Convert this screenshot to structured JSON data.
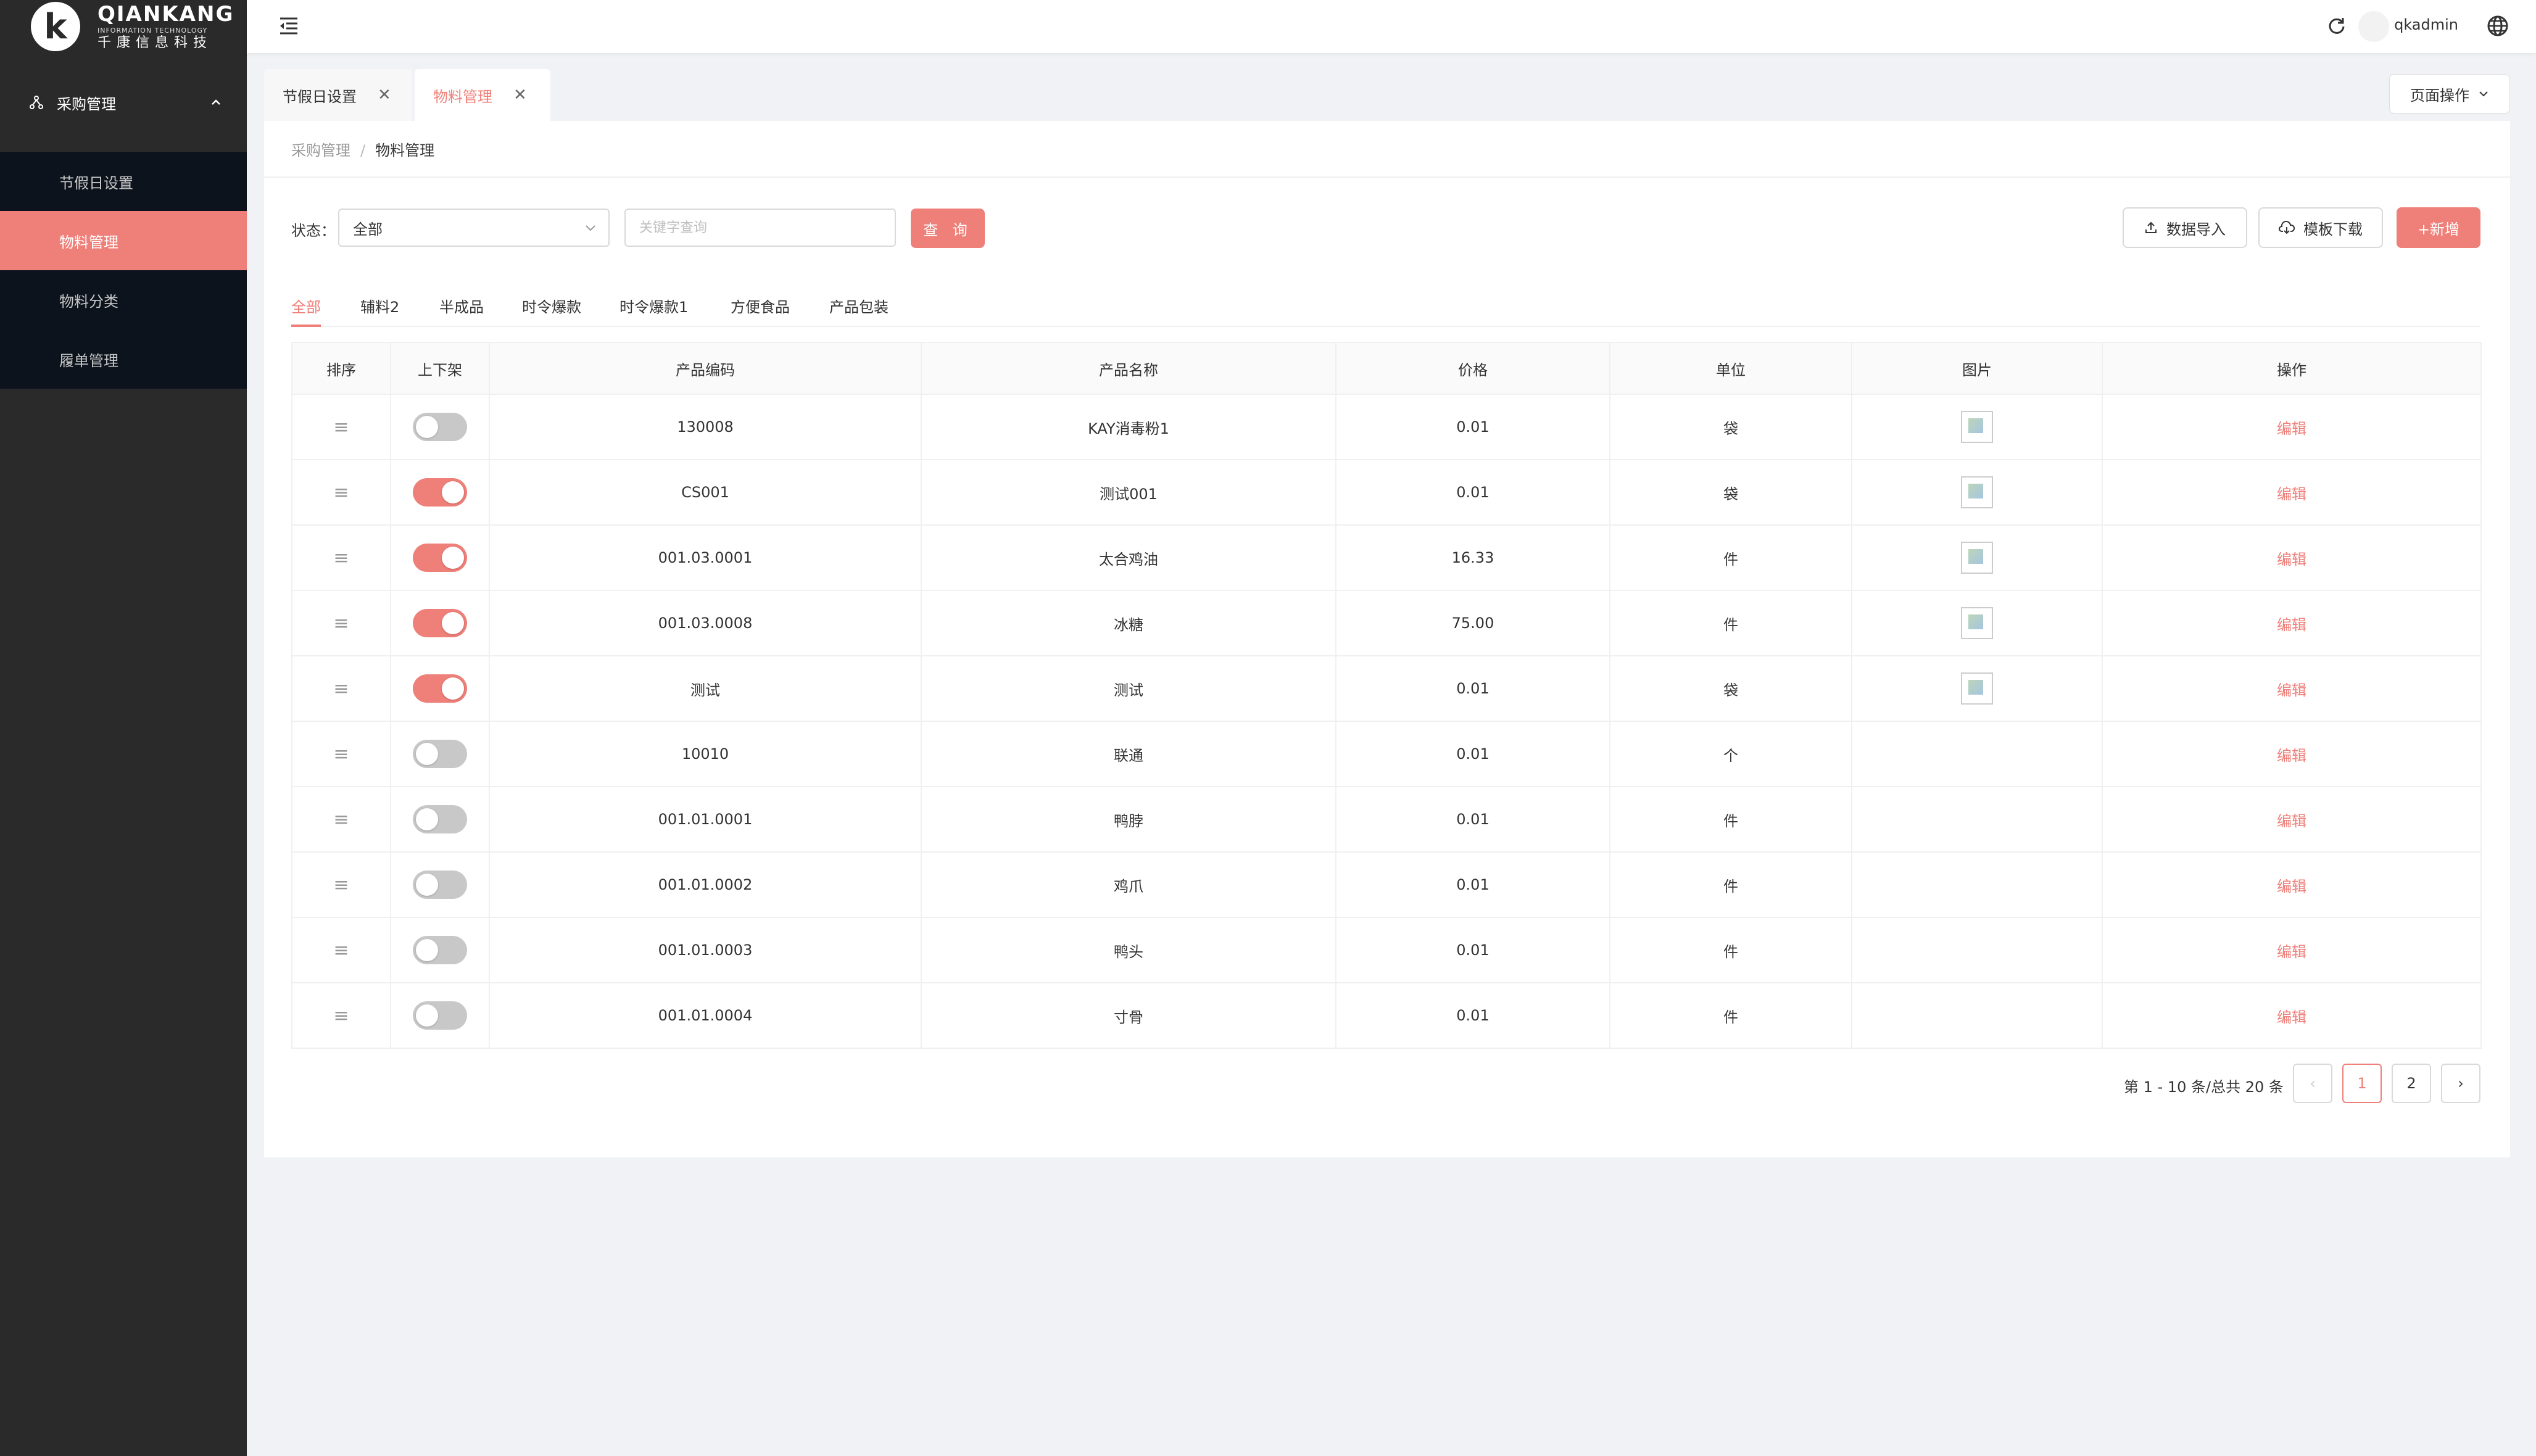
{
  "brand": {
    "mark": "k",
    "title": "QIANKANG",
    "subtitle": "INFORMATION TECHNOLOGY",
    "cn": "千康信息科技"
  },
  "sidebar": {
    "group": {
      "label": "采购管理",
      "icon": "sitemap-icon",
      "expanded": true
    },
    "items": [
      {
        "label": "节假日设置",
        "active": false
      },
      {
        "label": "物料管理",
        "active": true
      },
      {
        "label": "物料分类",
        "active": false
      },
      {
        "label": "履单管理",
        "active": false
      }
    ]
  },
  "header": {
    "username": "qkadmin"
  },
  "tabs": [
    {
      "label": "节假日设置",
      "active": false
    },
    {
      "label": "物料管理",
      "active": true
    }
  ],
  "page_ops_label": "页面操作",
  "breadcrumb": {
    "parent": "采购管理",
    "separator": "/",
    "current": "物料管理"
  },
  "filter": {
    "status_label": "状态：",
    "status_value": "全部",
    "search_placeholder": "关键字查询",
    "query_button": "查 询"
  },
  "actions": {
    "import": "数据导入",
    "template": "模板下载",
    "add": "+新增"
  },
  "categories": [
    {
      "label": "全部",
      "active": true
    },
    {
      "label": "辅料2",
      "active": false
    },
    {
      "label": "半成品",
      "active": false
    },
    {
      "label": "时令爆款",
      "active": false
    },
    {
      "label": "时令爆款1",
      "active": false
    },
    {
      "label": "方便食品",
      "active": false
    },
    {
      "label": "产品包装",
      "active": false
    }
  ],
  "table": {
    "headers": [
      "排序",
      "上下架",
      "产品编码",
      "产品名称",
      "价格",
      "单位",
      "图片",
      "操作"
    ],
    "edit_label": "编辑",
    "rows": [
      {
        "code": "130008",
        "name": "KAY消毒粉1",
        "price": "0.01",
        "unit": "袋",
        "on": false,
        "image": true
      },
      {
        "code": "CS001",
        "name": "测试001",
        "price": "0.01",
        "unit": "袋",
        "on": true,
        "image": true
      },
      {
        "code": "001.03.0001",
        "name": "太合鸡油",
        "price": "16.33",
        "unit": "件",
        "on": true,
        "image": true
      },
      {
        "code": "001.03.0008",
        "name": "冰糖",
        "price": "75.00",
        "unit": "件",
        "on": true,
        "image": true
      },
      {
        "code": "测试",
        "name": "测试",
        "price": "0.01",
        "unit": "袋",
        "on": true,
        "image": true
      },
      {
        "code": "10010",
        "name": "联通",
        "price": "0.01",
        "unit": "个",
        "on": false,
        "image": false
      },
      {
        "code": "001.01.0001",
        "name": "鸭脖",
        "price": "0.01",
        "unit": "件",
        "on": false,
        "image": false
      },
      {
        "code": "001.01.0002",
        "name": "鸡爪",
        "price": "0.01",
        "unit": "件",
        "on": false,
        "image": false
      },
      {
        "code": "001.01.0003",
        "name": "鸭头",
        "price": "0.01",
        "unit": "件",
        "on": false,
        "image": false
      },
      {
        "code": "001.01.0004",
        "name": "寸骨",
        "price": "0.01",
        "unit": "件",
        "on": false,
        "image": false
      }
    ]
  },
  "pagination": {
    "summary": "第 1 - 10 条/总共 20 条",
    "prev": "‹",
    "next": "›",
    "pages": [
      "1",
      "2"
    ],
    "current": "1"
  },
  "colors": {
    "accent": "#ef7f79",
    "sidebar_bg": "#2b2a2a",
    "submenu_bg": "#0c131c"
  }
}
